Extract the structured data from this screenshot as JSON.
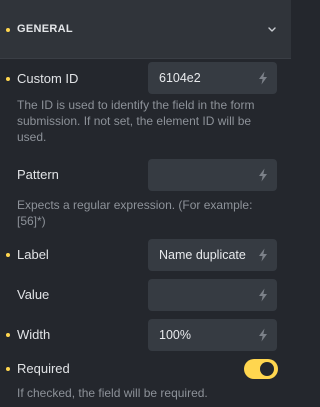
{
  "section": {
    "title": "GENERAL"
  },
  "fields": {
    "custom_id": {
      "label": "Custom ID",
      "value": "6104e2",
      "description": "The ID is used to identify the field in the form submission. If not set, the element ID will be used."
    },
    "pattern": {
      "label": "Pattern",
      "value": "",
      "description": "Expects a regular expression. (For example: [56]*)"
    },
    "label": {
      "label": "Label",
      "value": "Name duplicate"
    },
    "value": {
      "label": "Value",
      "value": ""
    },
    "width": {
      "label": "Width",
      "value": "100%"
    },
    "required": {
      "label": "Required",
      "enabled": true,
      "description": "If checked, the field will be required."
    }
  },
  "colors": {
    "accent": "#ffd64f",
    "background": "#24272d",
    "header_bg": "#30343a",
    "field_bg": "#363b42",
    "text": "#e1e3e6",
    "muted_text": "#8d9299"
  },
  "icons": {
    "collapse": "chevron-down-icon",
    "dynamic_data": "bolt-icon"
  }
}
